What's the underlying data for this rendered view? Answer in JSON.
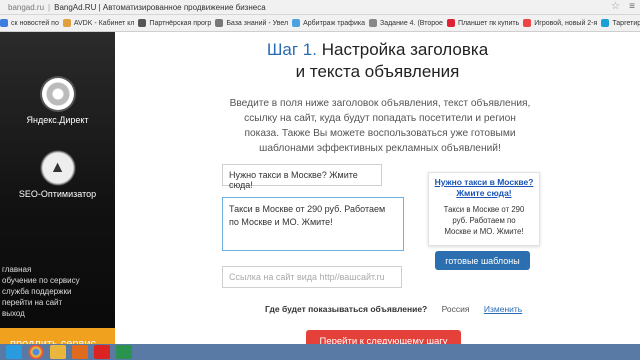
{
  "browser": {
    "host": "bangad.ru",
    "title": "BangAd.RU | Автоматизированное продвижение бизнеса",
    "bookmarks": [
      {
        "label": "ск новостей по",
        "color": "#3b7de0"
      },
      {
        "label": "AVDK - Кабинет кл",
        "color": "#e0a03b"
      },
      {
        "label": "Партнёрская прогр",
        "color": "#555555"
      },
      {
        "label": "База знаний - Увел",
        "color": "#777777"
      },
      {
        "label": "Арбитраж трафика",
        "color": "#4aa3df"
      },
      {
        "label": "Задание 4. (Второе",
        "color": "#888888"
      },
      {
        "label": "Планшет пк купить",
        "color": "#d23"
      },
      {
        "label": "Игровой, новый 2-я",
        "color": "#e44"
      },
      {
        "label": "Таргетированные о",
        "color": "#1aa0d8"
      }
    ]
  },
  "sidebar": {
    "yandex_label": "Яндекс.Директ",
    "seo_label": "SEO-Оптимизатор",
    "links": [
      "главная",
      "обучение по сервису",
      "служба поддержки",
      "перейти на сайт",
      "выход"
    ],
    "promo_label": "продлить сервис"
  },
  "main": {
    "title_step": "Шаг 1.",
    "title_rest": "Настройка заголовка",
    "title_line2": "и текста объявления",
    "description_lines": [
      "Введите в поля ниже заголовок объявления, текст объявления,",
      "ссылку на сайт, куда будут попадать посетители и регион",
      "показа. Также Вы можете воспользоваться уже готовыми",
      "шаблонами эффективных рекламных объявлений!"
    ],
    "ad_title_value": "Нужно такси в Москве? Жмите сюда!",
    "ad_text_value": "Такси в Москве от 290 руб. Работаем по Москве и МО. Жмите!",
    "site_placeholder": "Ссылка на сайт вида http//вашсайт.ru",
    "preview_title_lines": [
      "Нужно такси в Москве?",
      "Жмите сюда!"
    ],
    "preview_text_lines": [
      "Такси в Москве от 290",
      "руб. Работаем по",
      "Москве и МО. Жмите!"
    ],
    "templates_button": "готовые шаблоны",
    "region_question": "Где будет показываться объявление?",
    "region_value": "Россия",
    "region_change": "Изменить",
    "next_button": "Перейти к следующему шагу"
  }
}
